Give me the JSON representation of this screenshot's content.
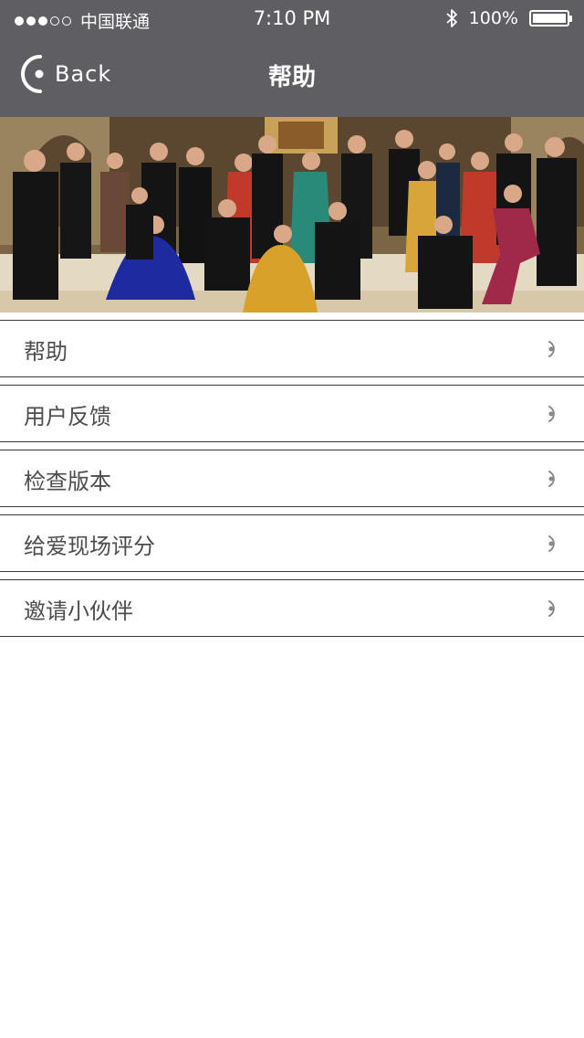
{
  "status": {
    "carrier": "中国联通",
    "time": "7:10 PM",
    "battery": "100%"
  },
  "nav": {
    "back_label": "Back",
    "title": "帮助"
  },
  "hero": {
    "image": "group-photo"
  },
  "menu": [
    {
      "label": "帮助"
    },
    {
      "label": "用户反馈"
    },
    {
      "label": "检查版本"
    },
    {
      "label": "给爱现场评分"
    },
    {
      "label": "邀请小伙伴"
    }
  ]
}
